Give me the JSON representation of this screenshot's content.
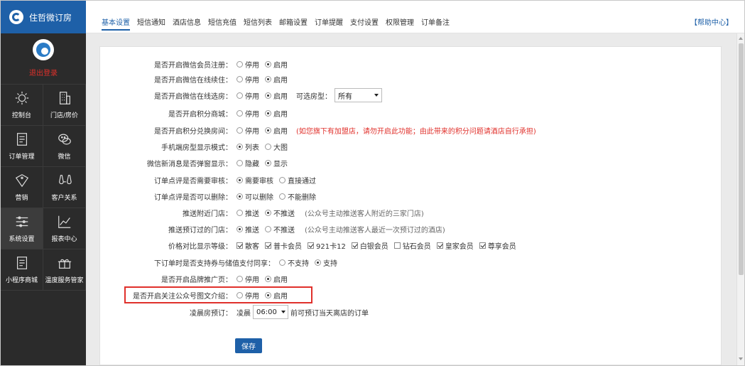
{
  "brand": {
    "name": "住哲微订房"
  },
  "profile": {
    "logout_label": "退出登录"
  },
  "nav": [
    {
      "label": "控制台",
      "icon": "sun-icon"
    },
    {
      "label": "门店/房价",
      "icon": "building-icon"
    },
    {
      "label": "订单管理",
      "icon": "document-icon"
    },
    {
      "label": "微信",
      "icon": "wechat-icon"
    },
    {
      "label": "营销",
      "icon": "sale-tag-icon"
    },
    {
      "label": "客户关系",
      "icon": "glasses-icon"
    },
    {
      "label": "系统设置",
      "icon": "sliders-icon"
    },
    {
      "label": "报表中心",
      "icon": "line-chart-icon"
    },
    {
      "label": "小程序商城",
      "icon": "document-icon"
    },
    {
      "label": "温度服务管家",
      "icon": "gift-icon"
    }
  ],
  "tabs": [
    "基本设置",
    "短信通知",
    "酒店信息",
    "短信充值",
    "短信列表",
    "邮箱设置",
    "订单提醒",
    "支付设置",
    "权限管理",
    "订单备注"
  ],
  "help_label": "【帮助中心】",
  "settings": {
    "member_register": {
      "label": "是否开启微信会员注册：",
      "opt1": "停用",
      "opt2": "启用"
    },
    "online_renew": {
      "label": "是否开启微信在线续住：",
      "opt1": "停用",
      "opt2": "启用"
    },
    "online_select_room": {
      "label": "是否开启微信在线选房：",
      "opt1": "停用",
      "opt2": "启用",
      "extra_label": "可选房型：",
      "select_value": "所有"
    },
    "points_mall": {
      "label": "是否开启积分商城：",
      "opt1": "停用",
      "opt2": "启用"
    },
    "points_exchange": {
      "label": "是否开启积分兑换房间：",
      "opt1": "停用",
      "opt2": "启用",
      "note": "(如您旗下有加盟店，请勿开启此功能；由此带来的积分问题请酒店自行承担)"
    },
    "mobile_room_display": {
      "label": "手机端房型显示模式：",
      "opt1": "列表",
      "opt2": "大图"
    },
    "wechat_popup": {
      "label": "微信新消息是否弹窗显示：",
      "opt1": "隐藏",
      "opt2": "显示"
    },
    "review_audit": {
      "label": "订单点评是否需要审核：",
      "opt1": "需要审核",
      "opt2": "直接通过"
    },
    "review_delete": {
      "label": "订单点评是否可以删除：",
      "opt1": "可以删除",
      "opt2": "不能删除"
    },
    "push_nearby": {
      "label": "推送附近门店：",
      "opt1": "推送",
      "opt2": "不推送",
      "note": "(公众号主动推送客人附近的三家门店)"
    },
    "push_booked": {
      "label": "推送预订过的门店：",
      "opt1": "推送",
      "opt2": "不推送",
      "note": "(公众号主动推送客人最近一次预订过的酒店)"
    },
    "price_compare": {
      "label": "价格对比显示等级：",
      "levels": [
        "散客",
        "普卡会员",
        "921卡12",
        "白银会员",
        "钻石会员",
        "皇家会员",
        "尊享会员"
      ]
    },
    "coupon_combo": {
      "label": "下订单时是否支持券与储值支付同享：",
      "opt1": "不支持",
      "opt2": "支持"
    },
    "brand_promo": {
      "label": "是否开启品牌推广页：",
      "opt1": "停用",
      "opt2": "启用"
    },
    "article_intro": {
      "label": "是否开启关注公众号图文介绍：",
      "opt1": "停用",
      "opt2": "启用"
    },
    "early_booking": {
      "label": "凌晨房预订：",
      "prefix": "凌晨",
      "select_value": "06:00",
      "suffix": "前可预订当天离店的订单"
    }
  },
  "save_label": "保存",
  "colors": {
    "brand_blue": "#1e60a8",
    "sidebar_bg": "#2b2b2b",
    "alert_red": "#e0302b"
  }
}
